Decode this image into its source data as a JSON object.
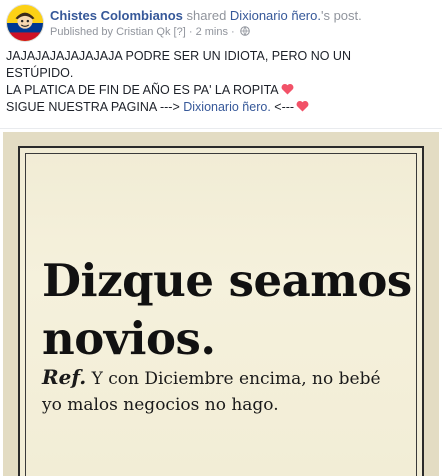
{
  "header": {
    "page_name": "Chistes Colombianos",
    "action_text": "shared",
    "shared_from": "Dixionario ñero.",
    "shared_suffix": "'s post.",
    "published_by_label": "Published by",
    "publisher": "Cristian Qk",
    "footnote_marker": "[?]",
    "separator": "·",
    "timestamp": "2 mins",
    "separator2": "·",
    "audience_icon": "globe-icon"
  },
  "post": {
    "line1": "JAJAJAJAJAJAJAJA PODRE SER UN IDIOTA, PERO NO UN",
    "line2": "ESTÚPIDO.",
    "line3": "LA PLATICA DE FIN DE AÑO ES PA' LA ROPITA",
    "line4_prefix": "SIGUE NUESTRA PAGINA --->",
    "line4_link": "Dixionario ñero.",
    "line4_suffix": "<---",
    "emoji": "heart-icon"
  },
  "image": {
    "headword_line1": "Dizque seamos",
    "headword_line2": "novios.",
    "ref_label": "Ref.",
    "definition_line1": "Y con Diciembre encima, no bebé",
    "definition_line2": "yo malos negocios no hago."
  },
  "colors": {
    "link": "#365899",
    "muted": "#90949c",
    "text": "#1d2129",
    "heart": "#f25268",
    "paper": "#f2edd6"
  }
}
